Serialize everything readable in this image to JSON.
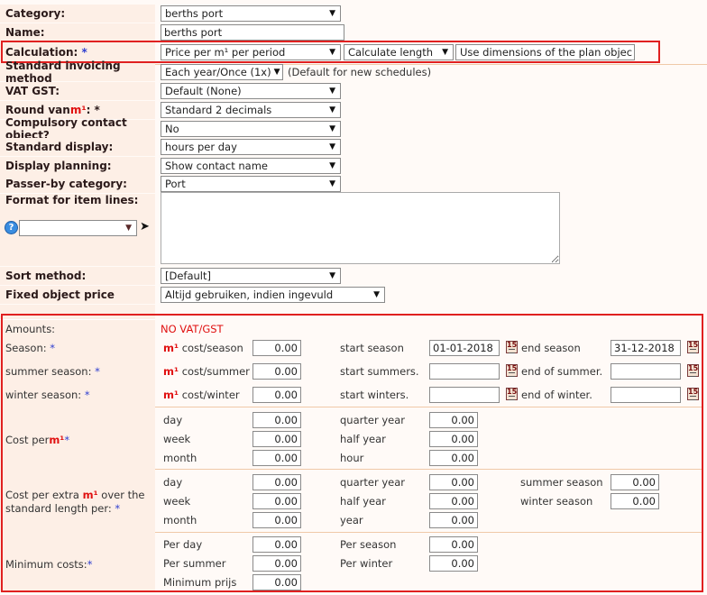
{
  "form": {
    "category": {
      "label": "Category:",
      "value": "berths port"
    },
    "name": {
      "label": "Name:",
      "value": "berths port"
    },
    "calculation": {
      "label": "Calculation:",
      "required": "*",
      "value": "Price per m¹ per period",
      "length_value": "Calculate length",
      "dimensions_value": "Use dimensions of the plan objec"
    },
    "invoicing": {
      "label": "Standard invoicing method",
      "value": "Each year/Once (1x)",
      "note": "(Default for new schedules)"
    },
    "vat": {
      "label": "VAT GST:",
      "value": "Default (None)"
    },
    "round": {
      "label_pre": "Round van ",
      "label_unit": "m¹",
      "label_post": ": *",
      "value": "Standard 2 decimals"
    },
    "compulsory": {
      "label": "Compulsory contact object?",
      "value": "No"
    },
    "display": {
      "label": "Standard display:",
      "value": "hours per day"
    },
    "planning": {
      "label": "Display planning:",
      "value": "Show contact name"
    },
    "passer": {
      "label": "Passer-by category:",
      "value": "Port"
    },
    "format": {
      "label": "Format for item lines:",
      "help_icon": "?",
      "select_value": "",
      "value": ""
    },
    "sort": {
      "label": "Sort method:",
      "value": "[Default]"
    },
    "fixed": {
      "label": "Fixed object price",
      "value": "Altijd gebruiken, indien ingevuld"
    }
  },
  "amounts": {
    "label": "Amounts:",
    "vat_note": "NO VAT/GST",
    "unit": "m¹",
    "star": "*",
    "seasons": [
      {
        "label": "Season:",
        "cost_label": "cost/season",
        "cost": "0.00",
        "start_label": "start season",
        "start": "01-01-2018",
        "end_label": "end season",
        "end": "31-12-2018",
        "cal_glyph": "15"
      },
      {
        "label": "summer season:",
        "cost_label": "cost/summer",
        "cost": "0.00",
        "start_label": "start summers.",
        "start": "",
        "end_label": "end of summer.",
        "end": "",
        "cal_glyph": "15"
      },
      {
        "label": "winter season:",
        "cost_label": "cost/winter",
        "cost": "0.00",
        "start_label": "start winters.",
        "start": "",
        "end_label": "end of winter.",
        "end": "",
        "cal_glyph": "15"
      }
    ],
    "cost_per": {
      "label_pre": "Cost per ",
      "label_post": "*",
      "col1": [
        {
          "label": "day",
          "value": "0.00"
        },
        {
          "label": "week",
          "value": "0.00"
        },
        {
          "label": "month",
          "value": "0.00"
        }
      ],
      "col2": [
        {
          "label": "quarter year",
          "value": "0.00"
        },
        {
          "label": "half year",
          "value": "0.00"
        },
        {
          "label": "hour",
          "value": "0.00"
        }
      ]
    },
    "cost_extra": {
      "label_pre": "Cost per extra ",
      "label_mid": " over the",
      "label_line2": "standard length per: ",
      "col1": [
        {
          "label": "day",
          "value": "0.00"
        },
        {
          "label": "week",
          "value": "0.00"
        },
        {
          "label": "month",
          "value": "0.00"
        }
      ],
      "col2": [
        {
          "label": "quarter year",
          "value": "0.00"
        },
        {
          "label": "half year",
          "value": "0.00"
        },
        {
          "label": "year",
          "value": "0.00"
        }
      ],
      "col3": [
        {
          "label": "summer season",
          "value": "0.00"
        },
        {
          "label": "winter season",
          "value": "0.00"
        }
      ]
    },
    "minimum": {
      "label": "Minimum costs: ",
      "col1": [
        {
          "label": "Per day",
          "value": "0.00"
        },
        {
          "label": "Per summer",
          "value": "0.00"
        },
        {
          "label": "Minimum prijs",
          "value": "0.00"
        }
      ],
      "col2": [
        {
          "label": "Per season",
          "value": "0.00"
        },
        {
          "label": "Per winter",
          "value": "0.00"
        }
      ]
    }
  }
}
